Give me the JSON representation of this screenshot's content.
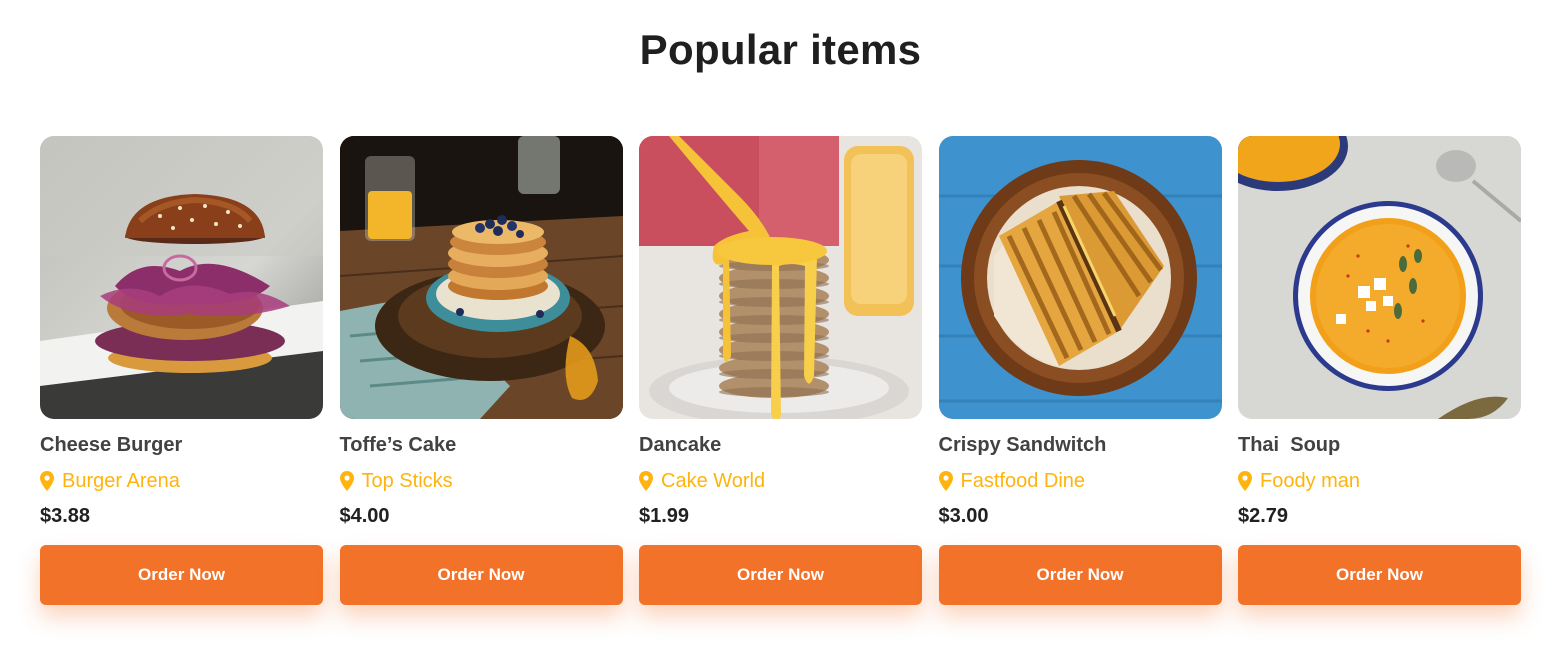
{
  "section": {
    "title": "Popular items"
  },
  "theme": {
    "accent": "#F17228",
    "location_color": "#FFB30E"
  },
  "items": [
    {
      "name": "Cheese Burger",
      "location": "Burger Arena",
      "price": "$3.88",
      "button": "Order Now",
      "photo": "cheese-burger-photo",
      "pin_icon": "map-pin-icon"
    },
    {
      "name": "Toffe’s Cake",
      "location": "Top Sticks",
      "price": "$4.00",
      "button": "Order Now",
      "photo": "pancake-stack-photo",
      "pin_icon": "map-pin-icon"
    },
    {
      "name": "Dancake",
      "location": "Cake World",
      "price": "$1.99",
      "button": "Order Now",
      "photo": "dancake-photo",
      "pin_icon": "map-pin-icon"
    },
    {
      "name": "Crispy Sandwitch",
      "location": "Fastfood Dine",
      "price": "$3.00",
      "button": "Order Now",
      "photo": "crispy-sandwich-photo",
      "pin_icon": "map-pin-icon"
    },
    {
      "name": "Thai  Soup",
      "location": "Foody man",
      "price": "$2.79",
      "button": "Order Now",
      "photo": "thai-soup-photo",
      "pin_icon": "map-pin-icon"
    }
  ]
}
